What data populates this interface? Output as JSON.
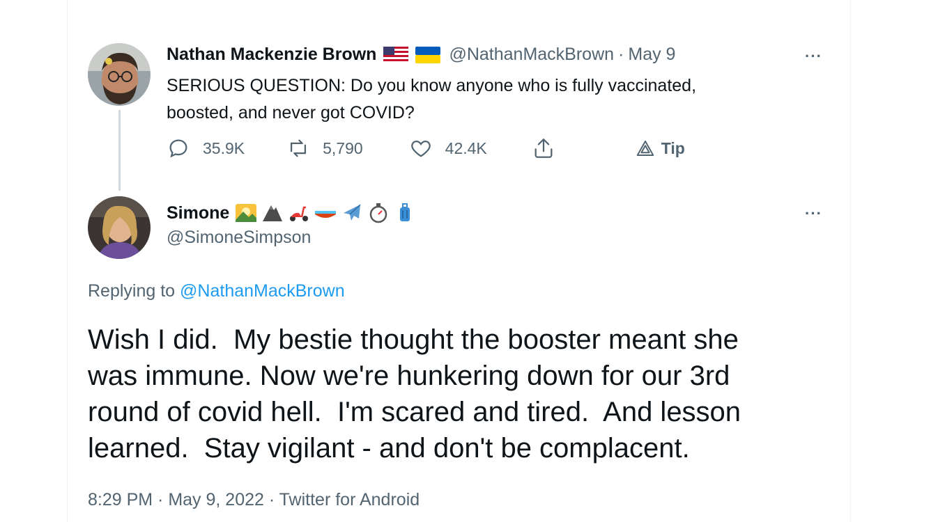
{
  "original_tweet": {
    "display_name": "Nathan Mackenzie Brown",
    "flags": [
      "us-flag-icon",
      "ukraine-flag-icon"
    ],
    "handle": "@NathanMackBrown",
    "separator": "·",
    "date": "May 9",
    "more_label": "···",
    "text_line1": "SERIOUS QUESTION: Do you know anyone who is fully vaccinated,",
    "text_line2": "boosted, and never got COVID?",
    "actions": {
      "reply_count": "35.9K",
      "retweet_count": "5,790",
      "like_count": "42.4K",
      "tip_label": "Tip"
    }
  },
  "reply_tweet": {
    "display_name": "Simone",
    "emojis": [
      "sunrise-over-mountains-icon",
      "mountain-icon",
      "motor-scooter-icon",
      "canoe-icon",
      "airplane-icon",
      "stopwatch-icon",
      "luggage-icon"
    ],
    "handle": "@SimoneSimpson",
    "more_label": "···",
    "replying_prefix": "Replying to",
    "replying_handle": "@NathanMackBrown",
    "text_line1": "Wish I did.  My bestie thought the booster meant she",
    "text_line2": "was immune. Now we're hunkering down for our 3rd",
    "text_line3": "round of covid hell.  I'm scared and tired.  And lesson",
    "text_line4": "learned.  Stay vigilant - and don't be complacent.",
    "timestamp": "8:29 PM · May 9, 2022 · Twitter for Android"
  },
  "colors": {
    "primary_text": "#0f1419",
    "secondary_text": "#536471",
    "link": "#1d9bf0",
    "thread_line": "#cfd9de"
  }
}
